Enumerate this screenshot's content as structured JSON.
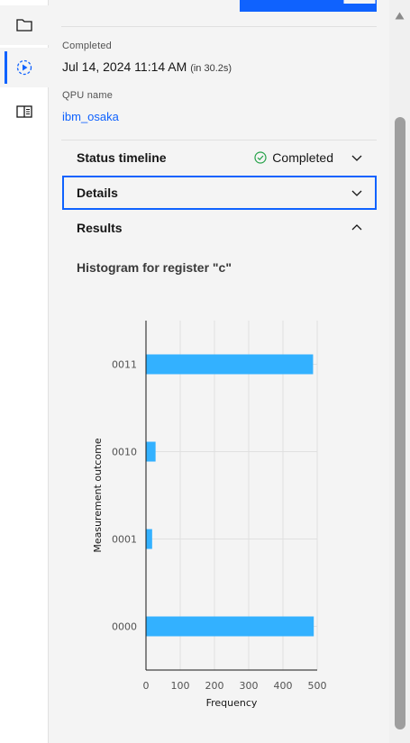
{
  "rail": {
    "items": [
      {
        "icon": "folder-icon"
      },
      {
        "icon": "job-run-icon"
      },
      {
        "icon": "book-icon"
      }
    ]
  },
  "job": {
    "completed_label": "Completed",
    "completed_date": "Jul 14, 2024 11:14 AM",
    "completed_duration": "(in 30.2s)",
    "qpu_label": "QPU name",
    "qpu_name": "ibm_osaka"
  },
  "accordion": {
    "status_timeline": {
      "title": "Status timeline",
      "status": "Completed",
      "status_color": "#24a148"
    },
    "details": {
      "title": "Details"
    },
    "results": {
      "title": "Results"
    }
  },
  "histogram_title": "Histogram for register \"c\"",
  "chart_data": {
    "type": "bar",
    "orientation": "horizontal",
    "categories": [
      "0011",
      "0010",
      "0001",
      "0000"
    ],
    "values": [
      488,
      28,
      18,
      490
    ],
    "xlabel": "Frequency",
    "ylabel": "Measurement outcome",
    "xlim": [
      0,
      500
    ],
    "xticks": [
      "0",
      "100",
      "200",
      "300",
      "400",
      "500"
    ],
    "bar_color": "#33b1ff",
    "grid": true
  },
  "colors": {
    "accent": "#0f62fe",
    "link": "#0f62fe"
  }
}
